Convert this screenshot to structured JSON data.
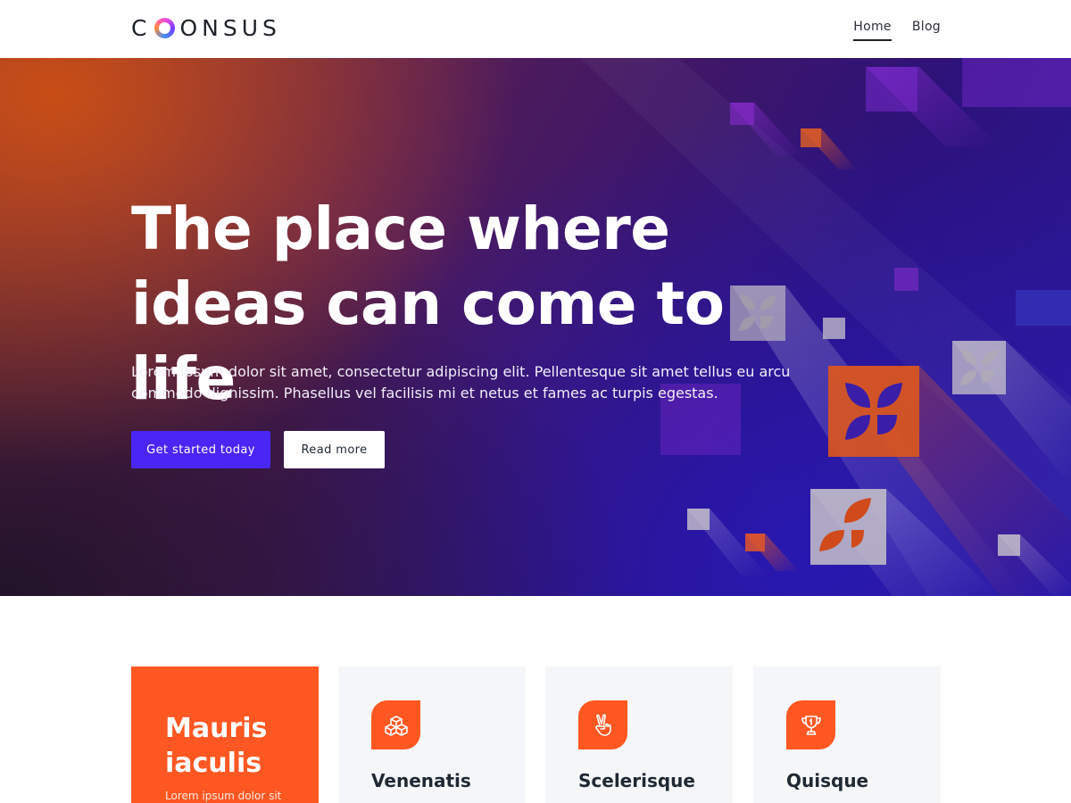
{
  "header": {
    "logo_text": "ONSUS",
    "logo_initial": "C",
    "nav": [
      {
        "label": "Home",
        "active": true
      },
      {
        "label": "Blog",
        "active": false
      }
    ]
  },
  "hero": {
    "title": "The place where ideas can come to life",
    "text": "Lorem ipsum dolor sit amet, consectetur adipiscing elit. Pellentesque sit amet tellus eu arcu commodo dignissim. Phasellus vel facilisis mi et netus et fames ac turpis egestas.",
    "primary_button": "Get started today",
    "secondary_button": "Read more"
  },
  "cards": {
    "featured": {
      "title": "Mauris iaculis",
      "subtitle": "Lorem ipsum dolor sit"
    },
    "items": [
      {
        "title": "Venenatis",
        "icon": "cubes-icon"
      },
      {
        "title": "Scelerisque",
        "icon": "peace-hand-icon"
      },
      {
        "title": "Quisque",
        "icon": "trophy-icon"
      }
    ]
  },
  "colors": {
    "accent_orange": "#ff5722",
    "primary_button": "#4a26f5",
    "card_bg": "#f4f6f8"
  }
}
